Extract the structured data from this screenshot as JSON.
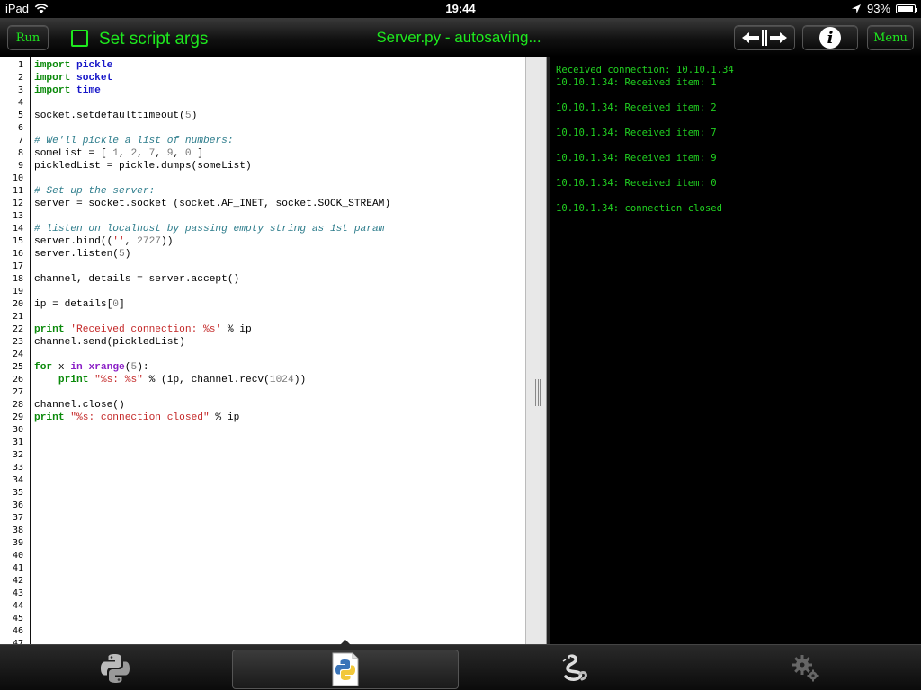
{
  "status_bar": {
    "device": "iPad",
    "time": "19:44",
    "battery": "93%",
    "battery_level": 0.93
  },
  "toolbar": {
    "run_label": "Run",
    "args_label": "Set script args",
    "args_checked": false,
    "title": "Server.py - autosaving...",
    "menu_label": "Menu",
    "accent_color": "#1ee81e"
  },
  "editor": {
    "line_numbers": [
      "1",
      "2",
      "3",
      "4",
      "5",
      "6",
      "7",
      "8",
      "9",
      "10",
      "11",
      "12",
      "13",
      "14",
      "15",
      "16",
      "17",
      "18",
      "19",
      "20",
      "21",
      "22",
      "23",
      "24",
      "25",
      "26",
      "27",
      "28",
      "29",
      "30",
      "31",
      "32",
      "33",
      "34",
      "35",
      "36",
      "37",
      "38",
      "39",
      "40",
      "41",
      "42",
      "43",
      "44",
      "45",
      "46",
      "47"
    ],
    "lines": [
      "import pickle",
      "import socket",
      "import time",
      "",
      "socket.setdefaulttimeout(5)",
      "",
      "# We'll pickle a list of numbers:",
      "someList = [ 1, 2, 7, 9, 0 ]",
      "pickledList = pickle.dumps(someList)",
      "",
      "# Set up the server:",
      "server = socket.socket (socket.AF_INET, socket.SOCK_STREAM)",
      "",
      "# listen on localhost by passing empty string as 1st param",
      "server.bind(('', 2727))",
      "server.listen(5)",
      "",
      "channel, details = server.accept()",
      "",
      "ip = details[0]",
      "",
      "print 'Received connection: %s' % ip",
      "channel.send(pickledList)",
      "",
      "for x in xrange(5):",
      "    print \"%s: %s\" % (ip, channel.recv(1024))",
      "",
      "channel.close()",
      "print \"%s: connection closed\" % ip"
    ]
  },
  "console": {
    "lines": [
      "Received connection: 10.10.1.34",
      "10.10.1.34: Received item: 1",
      "",
      "10.10.1.34: Received item: 2",
      "",
      "10.10.1.34: Received item: 7",
      "",
      "10.10.1.34: Received item: 9",
      "",
      "10.10.1.34: Received item: 0",
      "",
      "10.10.1.34: connection closed"
    ],
    "text_color": "#21d021"
  },
  "tabbar": {
    "tabs": [
      {
        "icon": "python-logo-icon"
      },
      {
        "icon": "script-document-icon",
        "selected": true
      },
      {
        "icon": "snake-icon"
      },
      {
        "icon": "gears-icon"
      }
    ]
  }
}
